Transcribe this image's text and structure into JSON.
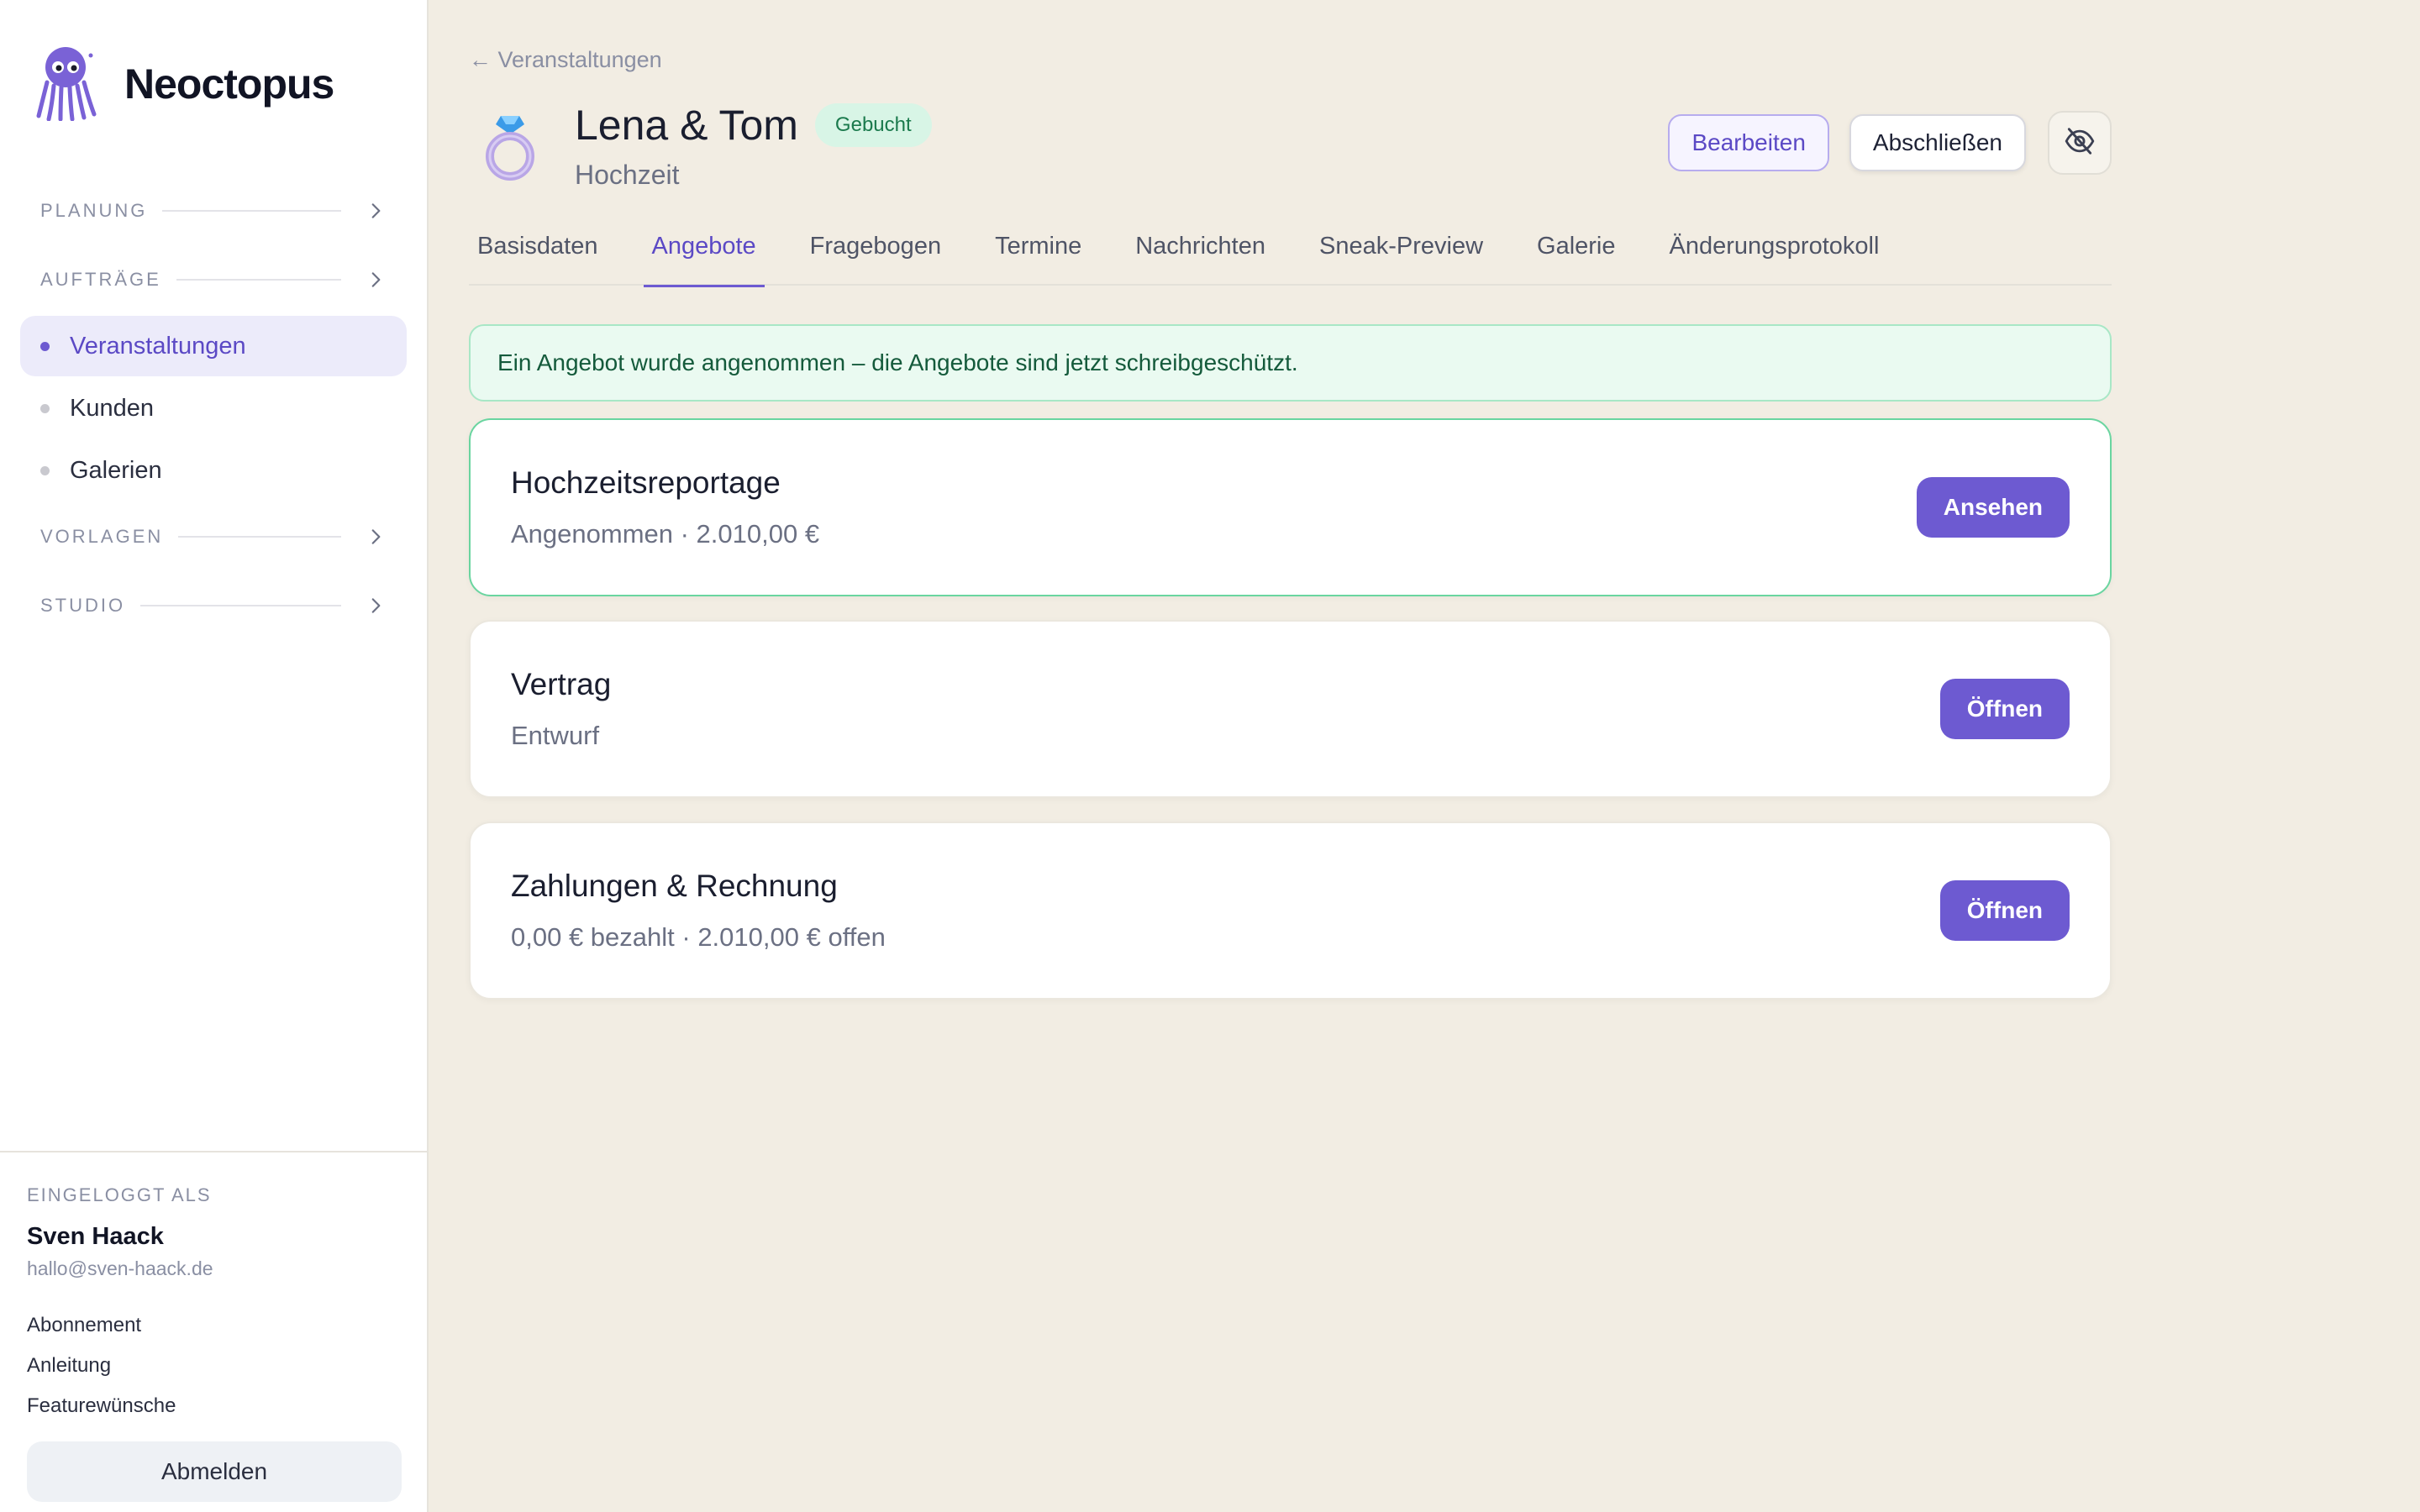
{
  "brand": {
    "name": "Neoctopus"
  },
  "sidebar": {
    "sections": {
      "planung": "PLANUNG",
      "auftraege": "AUFTRÄGE",
      "vorlagen": "VORLAGEN",
      "studio": "STUDIO"
    },
    "items": [
      {
        "label": "Veranstaltungen",
        "active": true
      },
      {
        "label": "Kunden",
        "active": false
      },
      {
        "label": "Galerien",
        "active": false
      }
    ]
  },
  "user": {
    "logged_in_label": "EINGELOGGT ALS",
    "name": "Sven Haack",
    "email": "hallo@sven-haack.de",
    "links": [
      "Abonnement",
      "Anleitung",
      "Featurewünsche"
    ],
    "logout_label": "Abmelden"
  },
  "page": {
    "breadcrumb": "← Veranstaltungen",
    "title": "Lena & Tom",
    "status_badge": "Gebucht",
    "subtitle": "Hochzeit",
    "edit_label": "Bearbeiten",
    "complete_label": "Abschließen",
    "visibility_icon": "eye-off-icon"
  },
  "tabs": [
    {
      "label": "Basisdaten",
      "active": false
    },
    {
      "label": "Angebote",
      "active": true
    },
    {
      "label": "Fragebogen",
      "active": false
    },
    {
      "label": "Termine",
      "active": false
    },
    {
      "label": "Nachrichten",
      "active": false
    },
    {
      "label": "Sneak-Preview",
      "active": false
    },
    {
      "label": "Galerie",
      "active": false
    },
    {
      "label": "Änderungsprotokoll",
      "active": false
    }
  ],
  "notice": "Ein Angebot wurde angenommen – die Angebote sind jetzt schreibgeschützt.",
  "cards": [
    {
      "title": "Hochzeitsreportage",
      "subtitle": "Angenommen · 2.010,00 €",
      "button": "Ansehen",
      "accepted": true
    },
    {
      "title": "Vertrag",
      "subtitle": "Entwurf",
      "button": "Öffnen",
      "accepted": false
    },
    {
      "title": "Zahlungen & Rechnung",
      "subtitle": "0,00 € bezahlt · 2.010,00 € offen",
      "button": "Öffnen",
      "accepted": false
    }
  ],
  "colors": {
    "accent": "#6d5ad1",
    "background": "#f2ede3",
    "success_bg": "#eafaf1",
    "success_border": "#6ad5a0",
    "badge_bg": "#d8f5e6",
    "badge_text": "#1b7a4d"
  }
}
